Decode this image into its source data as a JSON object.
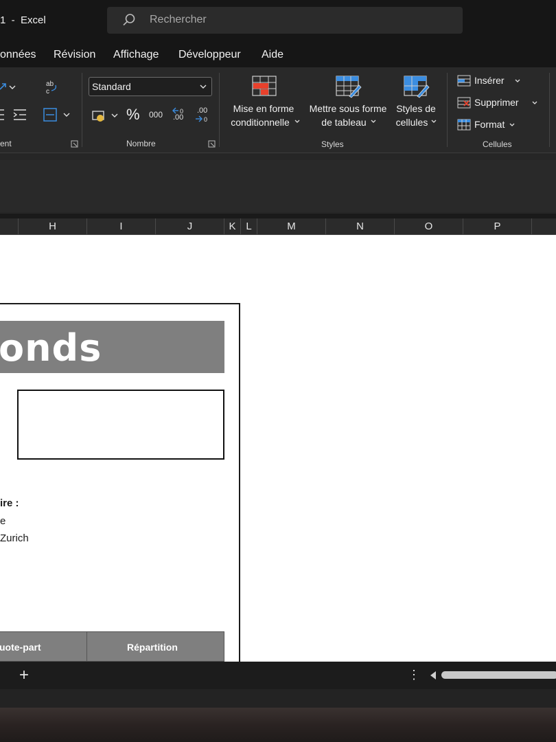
{
  "titlebar": {
    "app_title": "1  -  Excel",
    "search_placeholder": "Rechercher"
  },
  "menu": {
    "items": [
      "onnées",
      "Révision",
      "Affichage",
      "Développeur",
      "Aide"
    ]
  },
  "ribbon": {
    "alignment_group_label": "ent",
    "number_group": {
      "label": "Nombre",
      "format_value": "Standard",
      "percent": "%",
      "thousands": "000",
      "dec_increase": ".00",
      "dec_decrease": ".00"
    },
    "styles_group": {
      "label": "Styles",
      "conditional": [
        "Mise en forme",
        "conditionnelle"
      ],
      "as_table": [
        "Mettre sous forme",
        "de tableau"
      ],
      "cell_styles": [
        "Styles de",
        "cellules"
      ]
    },
    "cells_group": {
      "label": "Cellules",
      "insert": "Insérer",
      "delete": "Supprimer",
      "format": "Format"
    }
  },
  "columns": [
    "H",
    "I",
    "J",
    "K",
    "L",
    "M",
    "N",
    "O",
    "P"
  ],
  "document": {
    "banner_text": "onds",
    "label_bold": "ire :",
    "line1": "e",
    "line2": "Zurich",
    "table_headers": [
      "uote-part",
      "Répartition"
    ]
  },
  "sheet_tabs": {
    "add_label": "+",
    "more_label": "⋮"
  },
  "colors": {
    "accent_red": "#e8412c",
    "accent_blue": "#3b8de0",
    "banner_gray": "#7f7f7f"
  }
}
